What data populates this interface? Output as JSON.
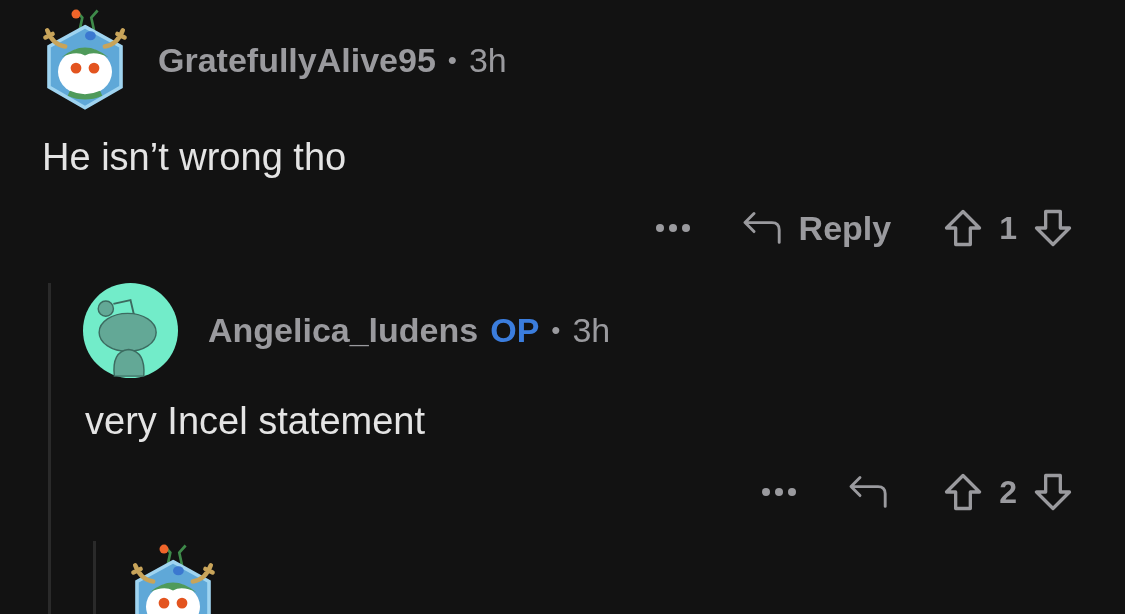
{
  "comments": [
    {
      "kind": "hexagon",
      "author": "GratefullyAlive95",
      "separator": "•",
      "time": "3h",
      "body": "He isn’t wrong tho",
      "reply_label": "Reply",
      "score": "1",
      "children": [
        {
          "kind": "circle",
          "author": "Angelica_ludens",
          "badge": "OP",
          "separator": "•",
          "time": "3h",
          "body": "very Incel statement",
          "score": "2",
          "children": [
            {
              "kind": "hexagon"
            }
          ]
        }
      ]
    }
  ]
}
